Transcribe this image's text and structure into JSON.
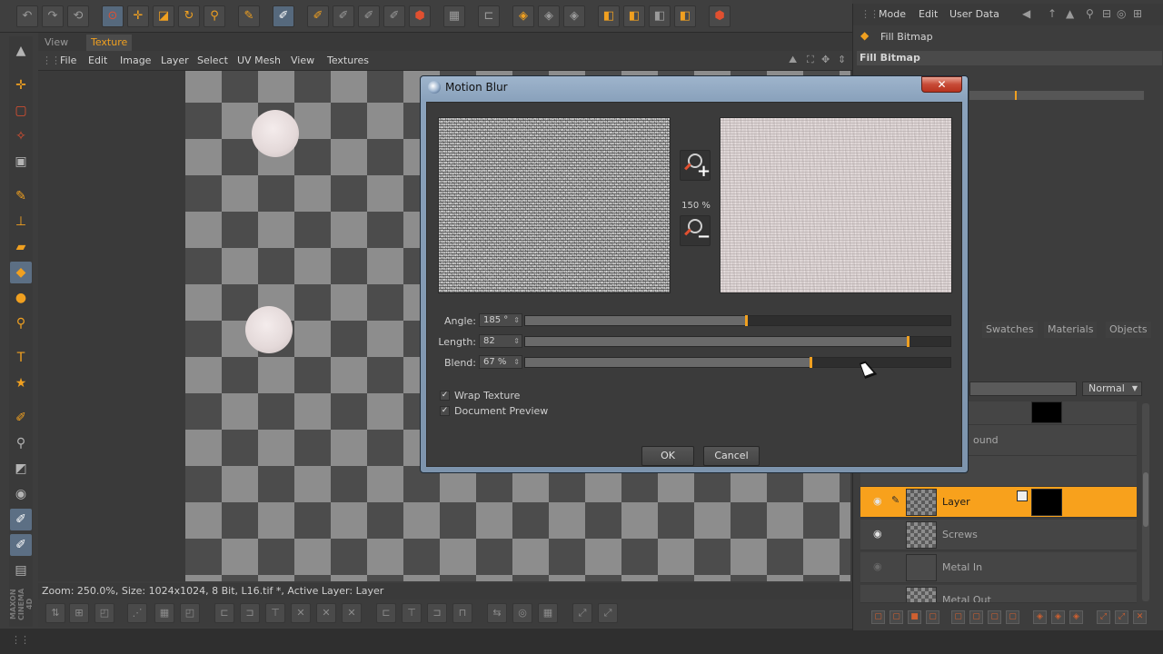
{
  "app": {
    "logo": "MAXON CINEMA 4D"
  },
  "view_tabs": [
    {
      "label": "View"
    },
    {
      "label": "Texture"
    }
  ],
  "menu": {
    "items": [
      "File",
      "Edit",
      "Image",
      "Layer",
      "Select",
      "UV Mesh",
      "View",
      "Textures"
    ]
  },
  "status": {
    "text": "Zoom: 250.0%, Size: 1024x1024, 8 Bit, L16.tif *, Active Layer: Layer"
  },
  "right_panel": {
    "menu": [
      "Mode",
      "Edit",
      "User Data"
    ],
    "tool_title": "Fill Bitmap",
    "section_title": "Fill Bitmap",
    "tabs": [
      "Swatches",
      "Materials",
      "Objects"
    ],
    "blend_mode": "Normal",
    "partial_layer_name": "ound",
    "layers": [
      {
        "name": "Layer",
        "selected": true
      },
      {
        "name": "Screws",
        "selected": false
      },
      {
        "name": "Metal In",
        "selected": false
      },
      {
        "name": "Metal Out",
        "selected": false
      }
    ]
  },
  "dialog": {
    "title": "Motion Blur",
    "close_label": "✕",
    "zoom_percent": "150 %",
    "params": [
      {
        "label": "Angle:",
        "value": "185 °",
        "fraction": 0.52
      },
      {
        "label": "Length:",
        "value": "82",
        "fraction": 0.9
      },
      {
        "label": "Blend:",
        "value": "67 %",
        "fraction": 0.67
      }
    ],
    "checkboxes": [
      {
        "label": "Wrap Texture",
        "checked": true
      },
      {
        "label": "Document Preview",
        "checked": true
      }
    ],
    "ok_label": "OK",
    "cancel_label": "Cancel"
  },
  "colors": {
    "accent": "#f0a020",
    "selected_layer": "#f8a11c",
    "dialog_frame": "#8aa2bc",
    "close_button": "#c74a36"
  }
}
